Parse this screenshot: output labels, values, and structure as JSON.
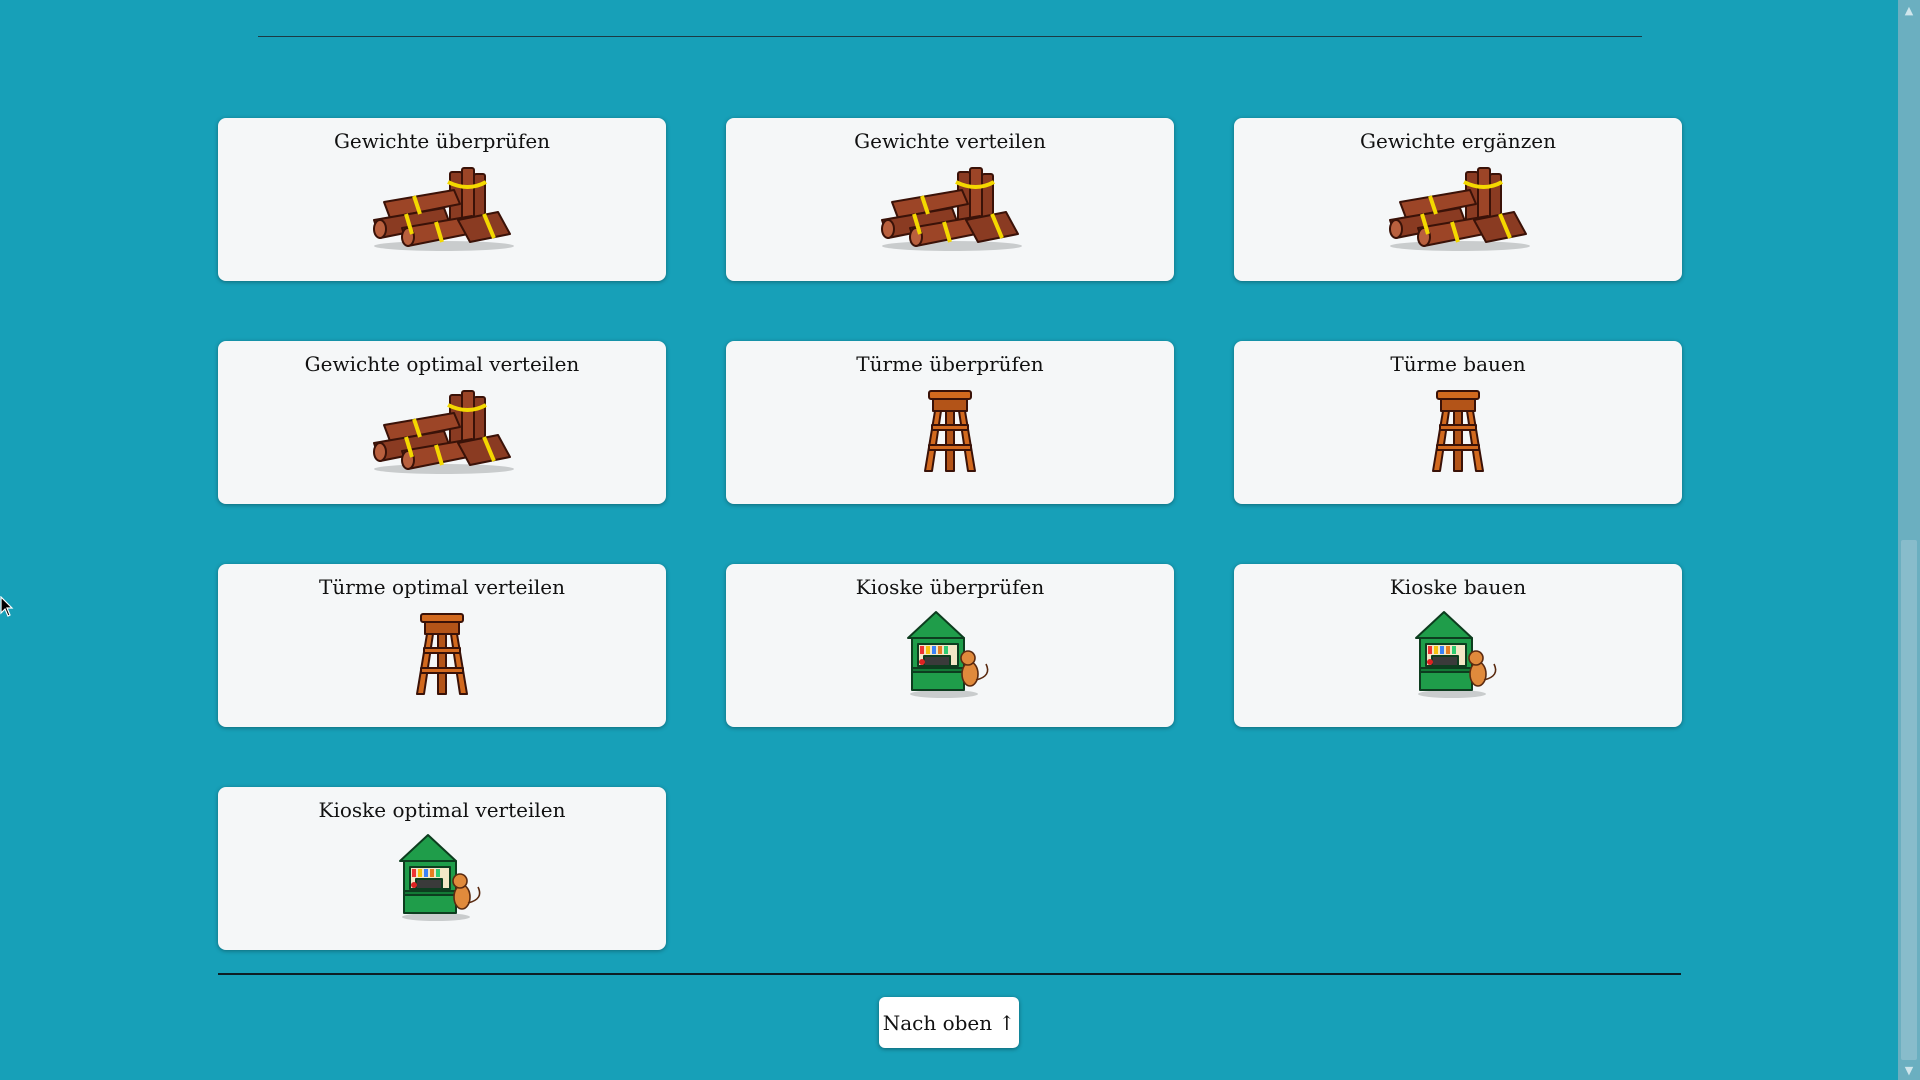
{
  "cards": [
    {
      "title": "Gewichte überprüfen",
      "icon": "wood-logs-icon"
    },
    {
      "title": "Gewichte verteilen",
      "icon": "wood-logs-icon"
    },
    {
      "title": "Gewichte ergänzen",
      "icon": "wood-logs-icon"
    },
    {
      "title": "Gewichte optimal verteilen",
      "icon": "wood-logs-icon"
    },
    {
      "title": "Türme überprüfen",
      "icon": "watchtower-icon"
    },
    {
      "title": "Türme bauen",
      "icon": "watchtower-icon"
    },
    {
      "title": "Türme optimal verteilen",
      "icon": "watchtower-icon"
    },
    {
      "title": "Kioske überprüfen",
      "icon": "kiosk-icon"
    },
    {
      "title": "Kioske bauen",
      "icon": "kiosk-icon"
    },
    {
      "title": "Kioske optimal verteilen",
      "icon": "kiosk-icon"
    }
  ],
  "back_to_top": "Nach oben ↑",
  "colors": {
    "background": "#17a0b8",
    "card": "#f5f7f8",
    "wood": "#8a3b22",
    "strap": "#f4d800",
    "kiosk_green": "#1f9d4a",
    "tower_orange": "#d2691e"
  }
}
